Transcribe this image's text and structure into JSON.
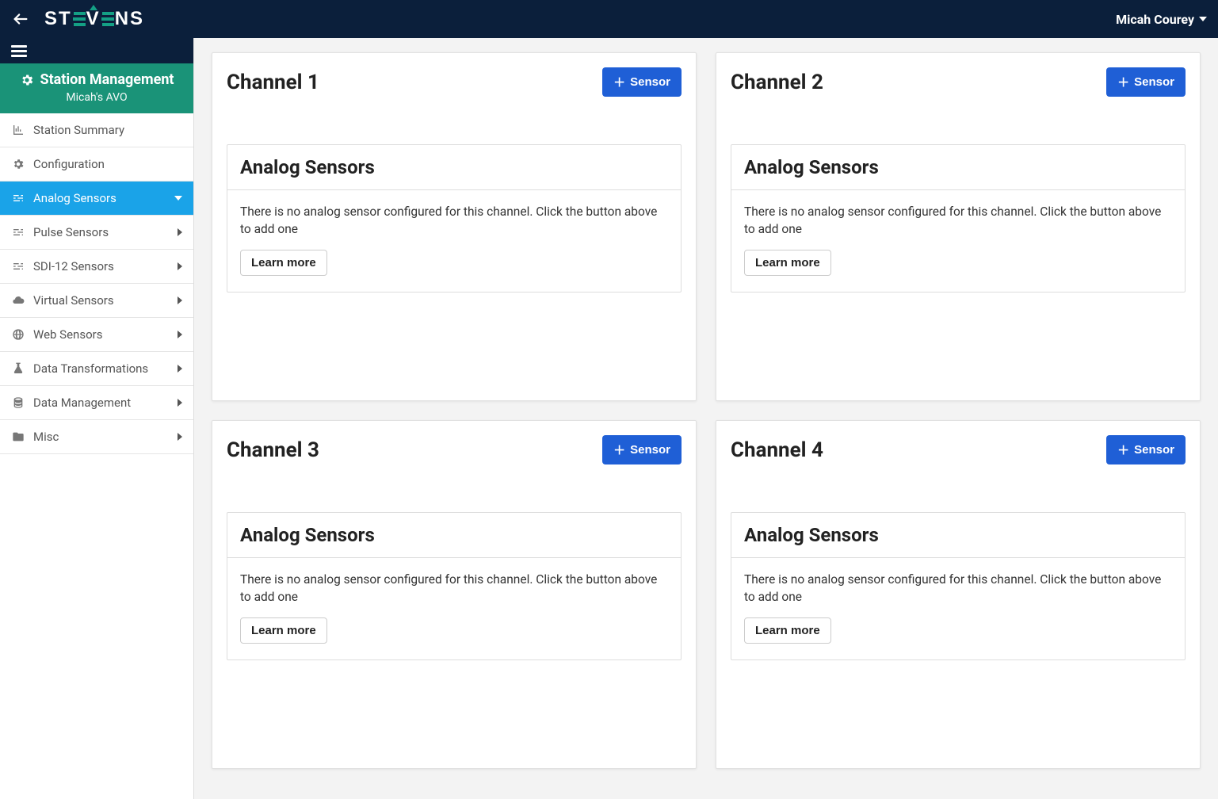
{
  "header": {
    "logo_text": "STEVENS",
    "user_name": "Micah Courey"
  },
  "sidebar": {
    "station_mgmt_label": "Station Management",
    "station_subtitle": "Micah's AVO",
    "items": [
      {
        "label": "Station Summary",
        "icon": "chart-icon",
        "expandable": false,
        "active": false
      },
      {
        "label": "Configuration",
        "icon": "gear-icon",
        "expandable": false,
        "active": false
      },
      {
        "label": "Analog Sensors",
        "icon": "sliders-icon",
        "expandable": true,
        "active": true
      },
      {
        "label": "Pulse Sensors",
        "icon": "sliders-icon",
        "expandable": true,
        "active": false
      },
      {
        "label": "SDI-12 Sensors",
        "icon": "sliders-icon",
        "expandable": true,
        "active": false
      },
      {
        "label": "Virtual Sensors",
        "icon": "cloud-icon",
        "expandable": true,
        "active": false
      },
      {
        "label": "Web Sensors",
        "icon": "globe-icon",
        "expandable": true,
        "active": false
      },
      {
        "label": "Data Transformations",
        "icon": "flask-icon",
        "expandable": true,
        "active": false
      },
      {
        "label": "Data Management",
        "icon": "database-icon",
        "expandable": true,
        "active": false
      },
      {
        "label": "Misc",
        "icon": "folder-icon",
        "expandable": true,
        "active": false
      }
    ]
  },
  "main": {
    "sensor_button_label": "Sensor",
    "sub_card_title": "Analog Sensors",
    "empty_message": "There is no analog sensor configured for this channel. Click the button above to add one",
    "learn_more_label": "Learn more",
    "channels": [
      {
        "title": "Channel 1"
      },
      {
        "title": "Channel 2"
      },
      {
        "title": "Channel 3"
      },
      {
        "title": "Channel 4"
      }
    ]
  }
}
